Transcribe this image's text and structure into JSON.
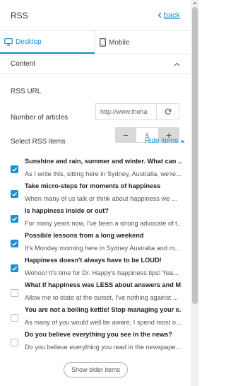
{
  "header": {
    "title": "RSS",
    "back_label": "back"
  },
  "tabs": [
    {
      "label": "Desktop",
      "icon": "desktop-icon",
      "active": true
    },
    {
      "label": "Mobile",
      "icon": "mobile-icon",
      "active": false
    }
  ],
  "content_section": {
    "label": "Content"
  },
  "rss_url": {
    "label": "RSS URL",
    "value": "http://www.theha"
  },
  "articles": {
    "label": "Number of articles",
    "value": "5",
    "minus": "−",
    "plus": "+"
  },
  "select_items": {
    "label": "Select RSS items",
    "hide_label": "Hide items"
  },
  "items": [
    {
      "checked": true,
      "title": "Sunshine and rain, summer and winter. What can ...",
      "desc": "As I write this, sitting here in Sydney, Australia, we're..."
    },
    {
      "checked": true,
      "title": "Take micro-steps for moments of happiness",
      "desc": "When many of us talk or think about happiness we ..."
    },
    {
      "checked": true,
      "title": "Is happiness inside or out?",
      "desc": "For many years now, I've been a strong advocate of t..."
    },
    {
      "checked": true,
      "title": "Possible lessons from a long weekend",
      "desc": "It's Monday morning here in Sydney Australia and m..."
    },
    {
      "checked": true,
      "title": "Happiness doesn't always have to be LOUD!",
      "desc": "Wohoo! It's time for Dr. Happy's happiness tips! Yea..."
    },
    {
      "checked": false,
      "title": "What if happiness was LESS about answers and M...",
      "desc": "Allow me to state at the outset, I've nothing against ..."
    },
    {
      "checked": false,
      "title": "You are not a boiling kettle! Stop managing your e...",
      "desc": "As many of you would well be aware, I spend most o..."
    },
    {
      "checked": false,
      "title": "Do you believe everything you see in the news?",
      "desc": "Do you believe everything you read in the newspape..."
    }
  ],
  "older_button": {
    "label": "Show older items"
  },
  "colors": {
    "accent": "#1a8fd1"
  }
}
